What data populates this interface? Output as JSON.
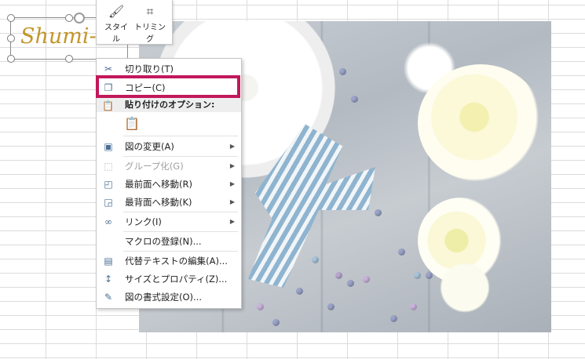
{
  "textbox": {
    "text": "Shumi-m"
  },
  "mini_toolbar": {
    "style_label": "スタイル",
    "style_icon": "brush-icon",
    "trim_label": "トリミング",
    "trim_icon": "crop-icon"
  },
  "menu": {
    "items": [
      {
        "label": "切り取り(T)",
        "icon": "scissors-icon",
        "disabled": false,
        "submenu": false
      },
      {
        "label": "コピー(C)",
        "icon": "copy-icon",
        "disabled": false,
        "submenu": false
      },
      {
        "label": "図の変更(A)",
        "icon": "change-picture-icon",
        "disabled": false,
        "submenu": true
      },
      {
        "label": "グループ化(G)",
        "icon": "group-icon",
        "disabled": true,
        "submenu": true
      },
      {
        "label": "最前面へ移動(R)",
        "icon": "bring-front-icon",
        "disabled": false,
        "submenu": true
      },
      {
        "label": "最背面へ移動(K)",
        "icon": "send-back-icon",
        "disabled": false,
        "submenu": true
      },
      {
        "label": "リンク(I)",
        "icon": "link-icon",
        "disabled": false,
        "submenu": true
      },
      {
        "label": "マクロの登録(N)...",
        "icon": "",
        "disabled": false,
        "submenu": false
      },
      {
        "label": "代替テキストの編集(A)...",
        "icon": "alt-text-icon",
        "disabled": false,
        "submenu": false
      },
      {
        "label": "サイズとプロパティ(Z)...",
        "icon": "size-properties-icon",
        "disabled": false,
        "submenu": false
      },
      {
        "label": "図の書式設定(O)...",
        "icon": "format-picture-icon",
        "disabled": false,
        "submenu": false
      }
    ],
    "paste_header": "貼り付けのオプション:",
    "paste_option_icon": "paste-icon"
  },
  "highlight": {
    "color": "#c2185b",
    "target": "コピー(C)"
  }
}
